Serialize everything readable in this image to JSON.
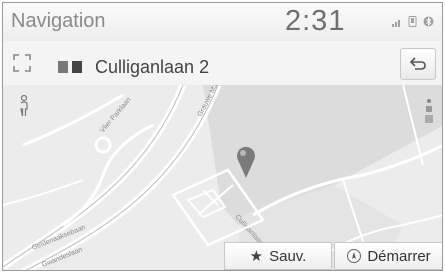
{
  "status_bar": {
    "app_title": "Navigation",
    "clock": "2:31",
    "icons": [
      "signal-icon",
      "phone-icon",
      "bluetooth-icon"
    ]
  },
  "route_bar": {
    "destination": "Culliganlaan 2",
    "expand_icon": "expand-icon",
    "back_icon": "back-arrow-icon"
  },
  "map": {
    "icons": [
      "person-icon",
      "poi-icon",
      "location-pin-icon"
    ],
    "pin_color": "#7a7a7a"
  },
  "actions": {
    "save_label": "Sauv.",
    "start_label": "Démarrer"
  }
}
